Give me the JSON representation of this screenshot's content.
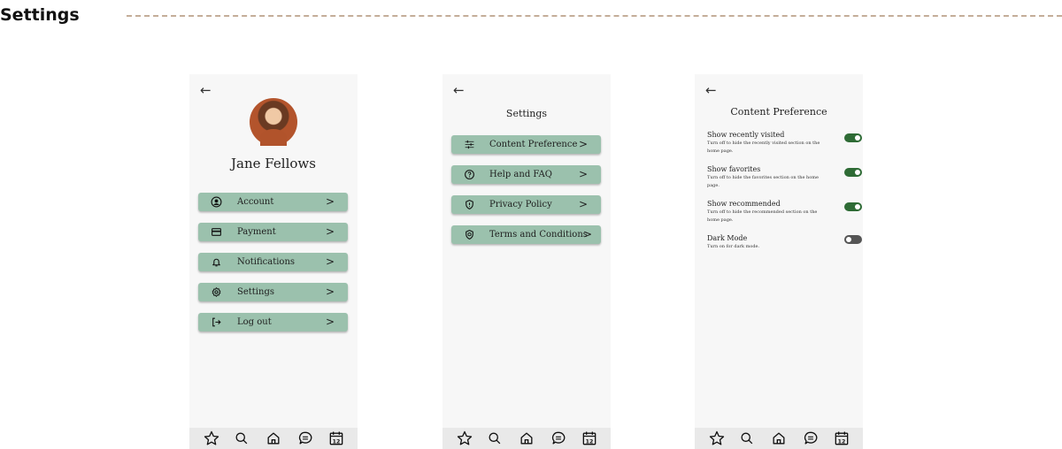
{
  "header": {
    "title": "Settings"
  },
  "phone1": {
    "back_icon": "arrow-left-icon",
    "profile_name": "Jane Fellows",
    "menu": [
      {
        "label": "Account",
        "icon": "user-circle-icon"
      },
      {
        "label": "Payment",
        "icon": "credit-card-icon"
      },
      {
        "label": "Notifications",
        "icon": "bell-icon"
      },
      {
        "label": "Settings",
        "icon": "gear-icon"
      },
      {
        "label": "Log out",
        "icon": "logout-icon"
      }
    ]
  },
  "phone2": {
    "back_icon": "arrow-left-icon",
    "title": "Settings",
    "menu": [
      {
        "label": "Content Preference",
        "icon": "sliders-icon"
      },
      {
        "label": "Help and FAQ",
        "icon": "question-circle-icon"
      },
      {
        "label": "Privacy Policy",
        "icon": "shield-icon"
      },
      {
        "label": "Terms and Conditions",
        "icon": "shield-check-icon"
      }
    ]
  },
  "phone3": {
    "back_icon": "arrow-left-icon",
    "title": "Content Preference",
    "prefs": [
      {
        "title": "Show recently visited",
        "desc": "Turn off to hide the recently visited section on the home page.",
        "enabled": true
      },
      {
        "title": "Show favorites",
        "desc": "Turn off to hide the favorites section on the home page.",
        "enabled": true
      },
      {
        "title": "Show recommended",
        "desc": "Turn off to hide the recommended section on the home page.",
        "enabled": true
      },
      {
        "title": "Dark Mode",
        "desc": "Turn on for dark mode.",
        "enabled": false
      }
    ]
  },
  "tabbar": {
    "icons": [
      "star-icon",
      "search-icon",
      "home-icon",
      "chat-icon",
      "calendar-icon"
    ],
    "calendar_day": "12"
  },
  "colors": {
    "button_green": "#9bc1ad",
    "toggle_on": "#2e6b35",
    "toggle_off": "#555555",
    "screen_bg": "#f7f7f7",
    "tabbar_bg": "#e9e9e9",
    "rule": "#c4ad99"
  }
}
